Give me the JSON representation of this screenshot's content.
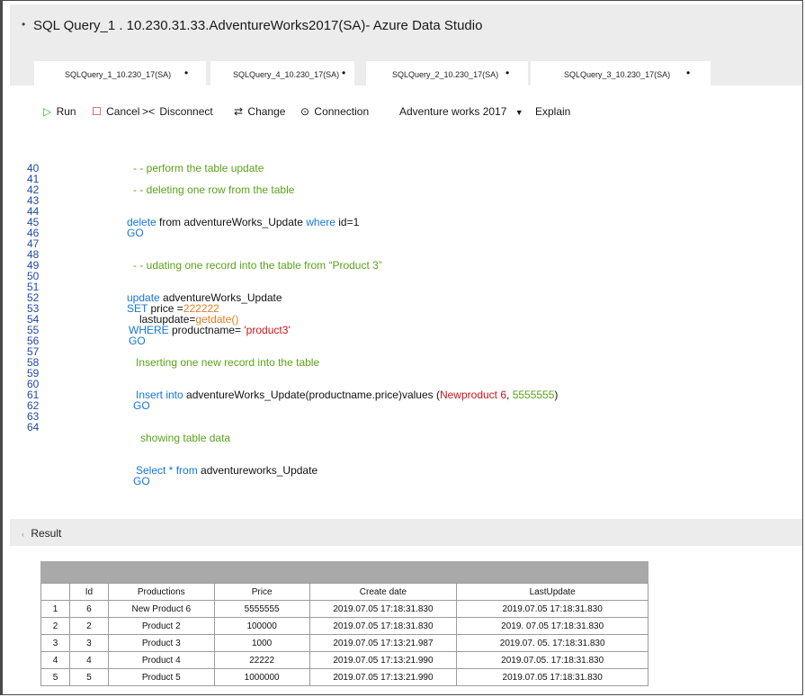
{
  "window": {
    "title": "SQL Query_1 . 10.230.31.33.AdventureWorks2017(SA)- Azure Data Studio",
    "title_bullet": "•"
  },
  "tabs": [
    {
      "label": "SQLQuery_1_10.230_17(SA)",
      "dot": "•"
    },
    {
      "label": "SQLQuery_4_10.230_17(SA)",
      "dot": "•"
    },
    {
      "label": "SQLQuery_2_10.230_17(SA)",
      "dot": "•"
    },
    {
      "label": "SQLQuery_3_10.230_17(SA)",
      "dot": "•"
    }
  ],
  "toolbar": {
    "run_icon": "▷",
    "run": "Run",
    "cancel_icon": "☐",
    "cancel": "Cancel",
    "disconnect_icon": "><",
    "disconnect": "Disconnect",
    "change_icon": "⇄",
    "change": "Change",
    "connection_icon": "⊙",
    "connection": "Connection",
    "database": "Adventure works 2017",
    "database_arrow": "▼",
    "explain": "Explain"
  },
  "editor": {
    "line_numbers": [
      "40",
      "41",
      "42",
      "43",
      "44",
      "45",
      "46",
      "47",
      "48",
      "49",
      "50",
      "51",
      "52",
      "53",
      "54",
      "55",
      "56",
      "57",
      "58",
      "59",
      "60",
      "61",
      "62",
      "63",
      "64"
    ],
    "lines": {
      "l40": {
        "c": "- - perform the table update"
      },
      "l42": {
        "c": "- - deleting one row from the table"
      },
      "l44": {
        "a": "delete",
        "b": " from adventureWorks_Update ",
        "c": "where",
        "d": " id=1"
      },
      "l45": {
        "a": "GO"
      },
      "l47": {
        "c": "- - udating one record into the table from “Product 3”"
      },
      "l49": {
        "a": "update",
        "b": " adventureWorks_Update"
      },
      "l50": {
        "a": "SET",
        "b": " price =",
        "c": "222222"
      },
      "l51": {
        "a": "lastupdate=",
        "b": "getdate()"
      },
      "l52": {
        "a": "WHERE",
        "b": " productname= ",
        "c": "'product3'"
      },
      "l53": {
        "a": "GO"
      },
      "l55": {
        "c": "Inserting one new record into the table"
      },
      "l57": {
        "a": "Insert into",
        "b": " adventureWorks_Update(productname.price)values (",
        "c": "Newproduct 6",
        "d": ",  ",
        "e": "5555555",
        "f": ")"
      },
      "l58": {
        "a": "GO"
      },
      "l60": {
        "c": "showing table data"
      },
      "l62": {
        "a": "Select * from",
        "b": " adventureworks_Update"
      },
      "l63": {
        "a": "GO"
      }
    }
  },
  "result": {
    "label": "Result",
    "arrow": "‹",
    "columns": [
      "",
      "Id",
      "Productions",
      "Price",
      "Create date",
      "LastUpdate"
    ],
    "rows": [
      [
        "1",
        "6",
        "New Product 6",
        "5555555",
        "2019.07.05 17:18:31.830",
        "2019.07.05 17:18:31.830"
      ],
      [
        "2",
        "2",
        "Product 2",
        "100000",
        "2019.07.05  17:18:31.830",
        "2019. 07.05 17:18:31.830"
      ],
      [
        "3",
        "3",
        "Product 3",
        "1000",
        "2019.07.05  17:13:21.987",
        "2019.07. 05. 17:18:31.830"
      ],
      [
        "4",
        "4",
        "Product 4",
        "22222",
        "2019.07.05  17:13:21.990",
        "2019.07.05. 17:18:31.830"
      ],
      [
        "5",
        "5",
        "Product 5",
        "1000000",
        "2019.07.05  17:13:21.990",
        "2019.07.05 17:18:31.830"
      ]
    ]
  },
  "colors": {
    "keyword": "#1476d6",
    "comment": "#5aa31a",
    "string": "#c8161d",
    "function": "#e67e22",
    "line_number": "#1f4aa8",
    "chrome": "#ececec"
  }
}
